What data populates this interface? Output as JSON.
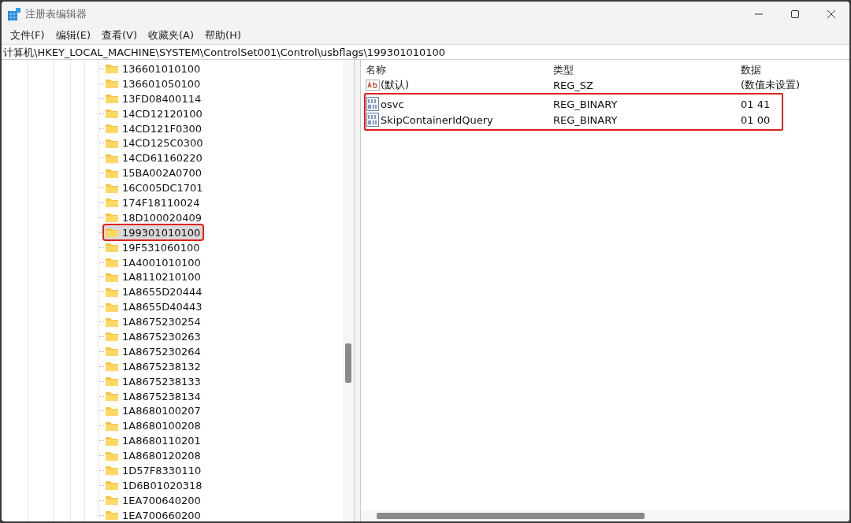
{
  "window": {
    "title": "注册表编辑器"
  },
  "menu": [
    "文件(F)",
    "编辑(E)",
    "查看(V)",
    "收藏夹(A)",
    "帮助(H)"
  ],
  "address": "计算机\\HKEY_LOCAL_MACHINE\\SYSTEM\\ControlSet001\\Control\\usbflags\\199301010100",
  "tree": [
    {
      "label": "136601010100",
      "selected": false,
      "highlighted": false
    },
    {
      "label": "136601050100",
      "selected": false,
      "highlighted": false
    },
    {
      "label": "13FD08400114",
      "selected": false,
      "highlighted": false
    },
    {
      "label": "14CD12120100",
      "selected": false,
      "highlighted": false
    },
    {
      "label": "14CD121F0300",
      "selected": false,
      "highlighted": false
    },
    {
      "label": "14CD125C0300",
      "selected": false,
      "highlighted": false
    },
    {
      "label": "14CD61160220",
      "selected": false,
      "highlighted": false
    },
    {
      "label": "15BA002A0700",
      "selected": false,
      "highlighted": false
    },
    {
      "label": "16C005DC1701",
      "selected": false,
      "highlighted": false
    },
    {
      "label": "174F18110024",
      "selected": false,
      "highlighted": false
    },
    {
      "label": "18D100020409",
      "selected": false,
      "highlighted": false
    },
    {
      "label": "199301010100",
      "selected": true,
      "highlighted": true
    },
    {
      "label": "19F531060100",
      "selected": false,
      "highlighted": false
    },
    {
      "label": "1A4001010100",
      "selected": false,
      "highlighted": false
    },
    {
      "label": "1A8110210100",
      "selected": false,
      "highlighted": false
    },
    {
      "label": "1A8655D20444",
      "selected": false,
      "highlighted": false
    },
    {
      "label": "1A8655D40443",
      "selected": false,
      "highlighted": false
    },
    {
      "label": "1A8675230254",
      "selected": false,
      "highlighted": false
    },
    {
      "label": "1A8675230263",
      "selected": false,
      "highlighted": false
    },
    {
      "label": "1A8675230264",
      "selected": false,
      "highlighted": false
    },
    {
      "label": "1A8675238132",
      "selected": false,
      "highlighted": false
    },
    {
      "label": "1A8675238133",
      "selected": false,
      "highlighted": false
    },
    {
      "label": "1A8675238134",
      "selected": false,
      "highlighted": false
    },
    {
      "label": "1A8680100207",
      "selected": false,
      "highlighted": false
    },
    {
      "label": "1A8680100208",
      "selected": false,
      "highlighted": false
    },
    {
      "label": "1A8680110201",
      "selected": false,
      "highlighted": false
    },
    {
      "label": "1A8680120208",
      "selected": false,
      "highlighted": false
    },
    {
      "label": "1D57F8330110",
      "selected": false,
      "highlighted": false
    },
    {
      "label": "1D6B01020318",
      "selected": false,
      "highlighted": false
    },
    {
      "label": "1EA700640200",
      "selected": false,
      "highlighted": false
    },
    {
      "label": "1EA700660200",
      "selected": false,
      "highlighted": false
    }
  ],
  "values": {
    "columns": [
      "名称",
      "类型",
      "数据"
    ],
    "rows": [
      {
        "kind": "string",
        "name": "(默认)",
        "type": "REG_SZ",
        "data": "(数值未设置)",
        "highlighted": false
      },
      {
        "kind": "binary",
        "name": "osvc",
        "type": "REG_BINARY",
        "data": "01 41",
        "highlighted": true
      },
      {
        "kind": "binary",
        "name": "SkipContainerIdQuery",
        "type": "REG_BINARY",
        "data": "01 00",
        "highlighted": true
      }
    ]
  }
}
